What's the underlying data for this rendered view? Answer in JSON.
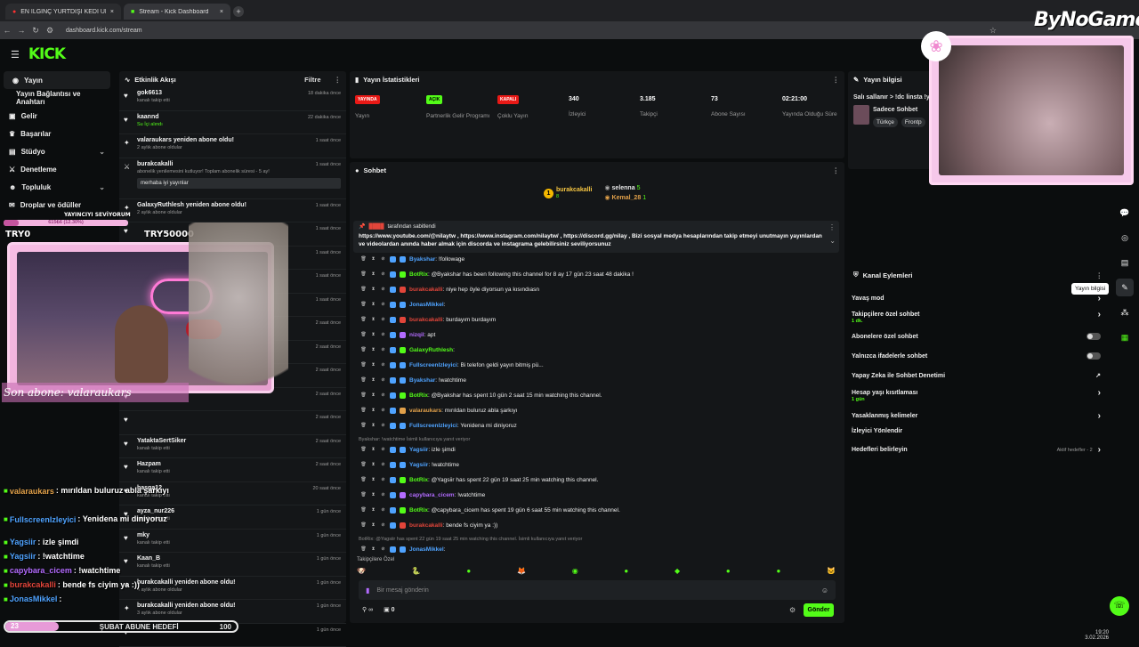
{
  "browser": {
    "tabs": [
      {
        "title": "EN İLGİNÇ YURTDIŞI KEDİ ÜRÜ",
        "active": false
      },
      {
        "title": "Stream - Kick Dashboard",
        "active": true
      }
    ],
    "url": "dashboard.kick.com/stream"
  },
  "watermark": "ByNoGame",
  "header": {
    "logo": "KICK"
  },
  "sidebar": {
    "items": [
      {
        "label": "Yayın",
        "icon": "radio-icon"
      },
      {
        "label": "Yayın Bağlantısı ve Anahtarı",
        "icon": ""
      },
      {
        "label": "Gelir",
        "icon": "dollar-icon"
      },
      {
        "label": "Başarılar",
        "icon": "trophy-icon"
      },
      {
        "label": "Stüdyo",
        "icon": "film-icon"
      },
      {
        "label": "Denetleme",
        "icon": "sword-icon"
      },
      {
        "label": "Topluluk",
        "icon": "users-icon"
      },
      {
        "label": "Droplar ve ödüller",
        "icon": "gift-icon"
      }
    ]
  },
  "feed": {
    "title": "Etkinlik Akışı",
    "filter_label": "Filtre",
    "items": [
      {
        "icon": "heart-icon",
        "name": "gok6613",
        "sub": "kanalı takip etti",
        "time": "18 dakika önce"
      },
      {
        "icon": "heart-icon",
        "name": "kaannd",
        "sub": "Su İçi alındı",
        "time": "22 dakika önce",
        "highlight": true
      },
      {
        "icon": "star-icon",
        "name": "valaraukars yeniden abone oldu!",
        "sub": "2 aylık abone oldular",
        "time": "1 saat önce"
      },
      {
        "icon": "sword-icon",
        "name": "burakcakalli",
        "sub": "abonelik yenilemesini kutluyor! Toplam abonelik süresi - 5 ay!",
        "time": "1 saat önce",
        "note": "merhaba iyi yayınlar"
      },
      {
        "icon": "star-icon",
        "name": "GalaxyRuthlesh yeniden abone oldu!",
        "sub": "2 aylık abone oldular",
        "time": "1 saat önce"
      },
      {
        "icon": "heart-icon",
        "name": "",
        "sub": "",
        "time": "1 saat önce"
      },
      {
        "icon": "heart-icon",
        "name": "",
        "sub": "",
        "time": "1 saat önce"
      },
      {
        "icon": "heart-icon",
        "name": "",
        "sub": "",
        "time": "1 saat önce"
      },
      {
        "icon": "heart-icon",
        "name": "",
        "sub": "",
        "time": "1 saat önce"
      },
      {
        "icon": "heart-icon",
        "name": "",
        "sub": "",
        "time": "2 saat önce"
      },
      {
        "icon": "heart-icon",
        "name": "",
        "sub": "",
        "time": "2 saat önce"
      },
      {
        "icon": "heart-icon",
        "name": "",
        "sub": "",
        "time": "2 saat önce"
      },
      {
        "icon": "heart-icon",
        "name": "",
        "sub": "",
        "time": "2 saat önce"
      },
      {
        "icon": "heart-icon",
        "name": "",
        "sub": "",
        "time": "2 saat önce"
      },
      {
        "icon": "heart-icon",
        "name": "YataktaSertSiker",
        "sub": "kanalı takip etti",
        "time": "2 saat önce"
      },
      {
        "icon": "heart-icon",
        "name": "Hazpam",
        "sub": "kanalı takip etti",
        "time": "2 saat önce"
      },
      {
        "icon": "heart-icon",
        "name": "hasga12",
        "sub": "kanalı takip etti",
        "time": "20 saat önce"
      },
      {
        "icon": "heart-icon",
        "name": "ayza_nur226",
        "sub": "kanalı takip etti",
        "time": "1 gün önce"
      },
      {
        "icon": "heart-icon",
        "name": "mky",
        "sub": "kanalı takip etti",
        "time": "1 gün önce"
      },
      {
        "icon": "heart-icon",
        "name": "Kaan_B",
        "sub": "kanalı takip etti",
        "time": "1 gün önce"
      },
      {
        "icon": "star-icon",
        "name": "burakcakalli yeniden abone oldu!",
        "sub": "4 aylık abone oldular",
        "time": "1 gün önce"
      },
      {
        "icon": "star-icon",
        "name": "burakcakalli yeniden abone oldu!",
        "sub": "3 aylık abone oldular",
        "time": "1 gün önce"
      },
      {
        "icon": "heart-icon",
        "name": "BoZARTben",
        "sub": "",
        "time": "1 gün önce"
      }
    ]
  },
  "stats": {
    "title": "Yayın İstatistikleri",
    "items": [
      {
        "value": "YAYINDA",
        "label": "Yayın",
        "badge": true,
        "color": "#e91916"
      },
      {
        "value": "AÇIK",
        "label": "Partnerlik Gelir Programı",
        "badge": true,
        "color": "#53fc18"
      },
      {
        "value": "KAPALI",
        "label": "Çoklu Yayın",
        "badge": true,
        "color": "#e91916"
      },
      {
        "value": "340",
        "label": "İzleyici",
        "badge": false
      },
      {
        "value": "3.185",
        "label": "Takipçi",
        "badge": false
      },
      {
        "value": "73",
        "label": "Abone Sayısı",
        "badge": false
      },
      {
        "value": "02:21:00",
        "label": "Yayında Olduğu Süre",
        "badge": false
      }
    ]
  },
  "chat": {
    "title": "Sohbet",
    "top_gifters": [
      {
        "name": "burakcakalli",
        "count": "8"
      },
      {
        "name": "selenna",
        "count": "5"
      },
      {
        "name": "Kemal_28",
        "count": "1"
      }
    ],
    "pinned_by": "tarafından sabitlendi",
    "pinned_text": "https://www.youtube.com/@nilaytw , https://www.instagram.com/nilaytw/ , https://discord.gg/nilay , Bizi sosyal medya hesaplarından takip etmeyi unutmayın yayınlardan ve videolardan anında haber almak için discorda ve instagrama gelebilirsiniz seviliyorsunuz",
    "messages": [
      {
        "user": "Byakshar",
        "text": ": !followage",
        "color": "#4fa3ff"
      },
      {
        "user": "BotRix",
        "text": ": @Byakshar has been following this channel for 8 ay 17 gün 23 saat 48 dakika !",
        "color": "#53fc18"
      },
      {
        "user": "burakcakalli",
        "text": ": niye hep öyle diyorsun ya kısındıasn",
        "color": "#e2453a"
      },
      {
        "user": "JonasMikkel",
        "text": ":",
        "color": "#4fa3ff"
      },
      {
        "user": "burakcakalli",
        "text": ": burdayım burdayım",
        "color": "#e2453a"
      },
      {
        "user": "nizqil",
        "text": ": apt",
        "color": "#b36bff"
      },
      {
        "user": "GalaxyRuthlesh",
        "text": ":",
        "color": "#53fc18"
      },
      {
        "user": "FullscreenIzleyici",
        "text": ": Bi telefon geldi yayın bitmiş pü...",
        "color": "#4fa3ff"
      },
      {
        "user": "Byakshar",
        "text": ": !watchtime",
        "color": "#4fa3ff"
      },
      {
        "user": "BotRix",
        "text": ": @Byakshar has spent 10 gün 2 saat 15 min watching this channel.",
        "color": "#53fc18"
      },
      {
        "user": "valaraukars",
        "text": ": mırıldan buluruz abla şarkıyı",
        "color": "#e2a14a"
      },
      {
        "user": "FullscreenIzleyici",
        "text": ": Yenidena mi diniyoruz",
        "color": "#4fa3ff"
      },
      {
        "user": "Yagsiir",
        "text": ": izle şimdi",
        "color": "#4fa3ff",
        "reply": "Byakshar: !watchtime İsimli kullanıcıya yanıt veriyor"
      },
      {
        "user": "Yagsiir",
        "text": ": !watchtime",
        "color": "#4fa3ff"
      },
      {
        "user": "BotRix",
        "text": ": @Yagsiir has spent 22 gün 19 saat 25 min watching this channel.",
        "color": "#53fc18"
      },
      {
        "user": "capybara_cicem",
        "text": ": !watchtime",
        "color": "#b36bff"
      },
      {
        "user": "BotRix",
        "text": ": @capybara_cicem has spent 19 gün 6 saat 55 min watching this channel.",
        "color": "#53fc18"
      },
      {
        "user": "burakcakalli",
        "text": ": bende fs ciyim ya :))",
        "color": "#e2453a"
      },
      {
        "user": "JonasMikkel",
        "text": ":",
        "color": "#4fa3ff",
        "reply": "BotRix: @Yagsiir has spent 22 gün 19 saat 25 min watching this channel. İsimli kullanıcıya yanıt veriyor"
      }
    ],
    "followers_only_label": "Takipçilere Özel",
    "input_placeholder": "Bir mesaj gönderin",
    "send_label": "Gönder",
    "counter_value": "0"
  },
  "info": {
    "title": "Yayın bilgisi",
    "stream_title": "Salı sallanır > !dc linsta !y",
    "category": "Sadece Sohbet",
    "tags": [
      "Türkçe",
      "Frontp"
    ]
  },
  "channel_actions": {
    "title": "Kanal Eylemleri",
    "items": [
      {
        "label": "Yavaş mod",
        "control": "chevron",
        "sub": ""
      },
      {
        "label": "Takipçilere özel sohbet",
        "control": "chevron",
        "sub": "1 dk."
      },
      {
        "label": "Abonelere özel sohbet",
        "control": "toggle",
        "sub": ""
      },
      {
        "label": "Yalnızca ifadelerle sohbet",
        "control": "toggle",
        "sub": ""
      },
      {
        "label": "Yapay Zeka ile Sohbet Denetimi",
        "control": "external",
        "sub": ""
      },
      {
        "label": "Hesap yaşı kısıtlaması",
        "control": "chevron",
        "sub": "1 gün"
      },
      {
        "label": "Yasaklanmış kelimeler",
        "control": "chevron",
        "sub": ""
      },
      {
        "label": "İzleyici Yönlendir",
        "control": "none",
        "sub": ""
      },
      {
        "label": "Hedefleri belirleyin",
        "control": "chevron",
        "sub": "",
        "extra": "Aktif hedefler - 2"
      }
    ]
  },
  "tooltip": "Yayın bilgisi",
  "overlay": {
    "supporter_label": "YAYINCIYI SEVİYORUM",
    "supporter_progress": "615₺6 (12.30%)",
    "try_left": "TRY0",
    "try_right": "TRY50000",
    "last_sub": "Son abone: valaraukars",
    "chat": [
      {
        "user": "valaraukars",
        "text": ": mırıldan buluruz abla şarkıyı",
        "color": "#e2a14a"
      },
      {
        "user": "FullscreenIzleyici",
        "text": ": Yenidena mi diniyoruz",
        "color": "#4fa3ff"
      },
      {
        "user": "Yagsiir",
        "text": ": izle şimdi",
        "color": "#4fa3ff"
      },
      {
        "user": "Yagsiir",
        "text": ": !watchtime",
        "color": "#4fa3ff"
      },
      {
        "user": "capybara_cicem",
        "text": ": !watchtime",
        "color": "#b36bff"
      },
      {
        "user": "burakcakalli",
        "text": ": bende fs ciyim ya :))",
        "color": "#e2453a"
      },
      {
        "user": "JonasMikkel",
        "text": ":",
        "color": "#4fa3ff"
      }
    ],
    "goal_current": "23",
    "goal_label": "ŞUBAT ABUNE HEDEFİ",
    "goal_target": "100"
  },
  "taskbar": {
    "time": "19:20",
    "date": "3.02.2026"
  },
  "colors": {
    "kick_green": "#53fc18",
    "live_red": "#e91916",
    "panel": "#141618",
    "pink_frame": "#f4b3e0"
  }
}
